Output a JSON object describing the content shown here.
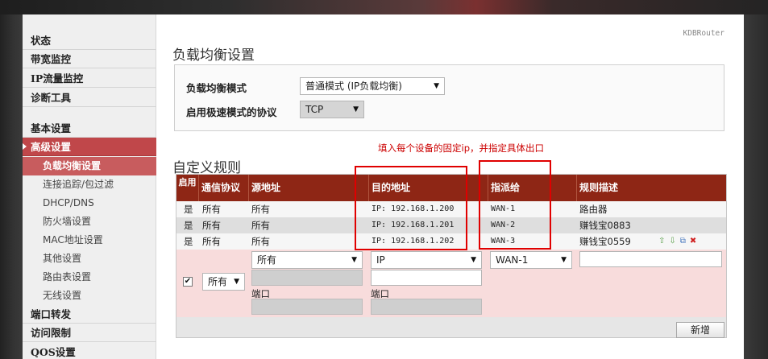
{
  "brand": "KDBRouter",
  "sidebar": {
    "groups": [
      {
        "label": "状态"
      },
      {
        "label": "带宽监控"
      },
      {
        "label": "IP流量监控"
      },
      {
        "label": "诊断工具"
      },
      {
        "label": "基本设置"
      },
      {
        "label": "高级设置"
      }
    ],
    "sub_items": [
      {
        "label": "负载均衡设置"
      },
      {
        "label": "连接追踪/包过滤"
      },
      {
        "label": "DHCP/DNS"
      },
      {
        "label": "防火墙设置"
      },
      {
        "label": "MAC地址设置"
      },
      {
        "label": "其他设置"
      },
      {
        "label": "路由表设置"
      },
      {
        "label": "无线设置"
      }
    ],
    "tail": [
      {
        "label": "端口转发"
      },
      {
        "label": "访问限制"
      },
      {
        "label": "QOS设置"
      }
    ]
  },
  "page_title": "负载均衡设置",
  "settings": {
    "mode_label": "负载均衡模式",
    "mode_value": "普通模式 (IP负载均衡)",
    "proto_label": "启用极速模式的协议",
    "proto_value": "TCP"
  },
  "hint": "填入每个设备的固定ip，并指定具体出口",
  "rules_title": "自定义规则",
  "table": {
    "headers": [
      "启用",
      "通信协议",
      "源地址",
      "目的地址",
      "指派给",
      "规则描述"
    ],
    "rows": [
      [
        "是",
        "所有",
        "所有",
        "IP: 192.168.1.200",
        "WAN-1",
        "路由器"
      ],
      [
        "是",
        "所有",
        "所有",
        "IP: 192.168.1.201",
        "WAN-2",
        "赚钱宝0883"
      ],
      [
        "是",
        "所有",
        "所有",
        "IP: 192.168.1.202",
        "WAN-3",
        "赚钱宝0559"
      ]
    ],
    "row_icons": "⇧⇩⧉✖"
  },
  "new_rule": {
    "enabled_check": "✔",
    "protocol": "所有",
    "src_select": "所有",
    "src_port_label": "端口",
    "dst_select": "IP",
    "dst_port_label": "端口",
    "assign": "WAN-1",
    "desc_value": ""
  },
  "add_button": "新增",
  "colors": {
    "accent": "#c0474a",
    "table_header": "#8e2615",
    "annotation": "#e00000"
  }
}
